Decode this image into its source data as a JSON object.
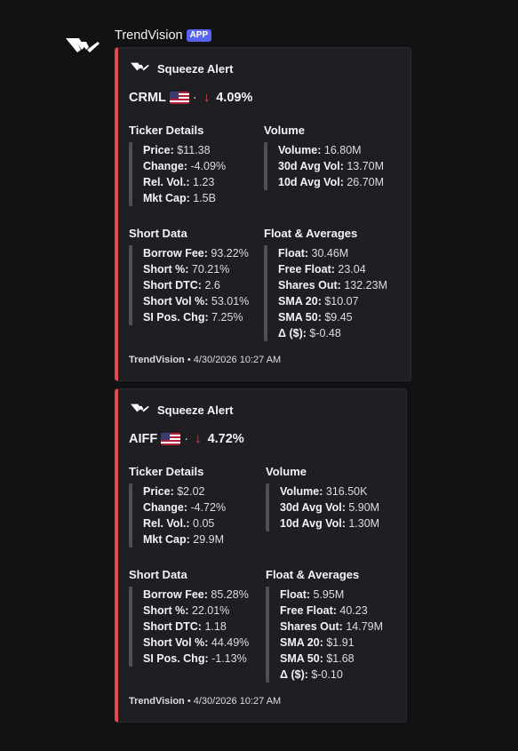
{
  "message": {
    "username": "TrendVision",
    "badge": "APP",
    "avatar_icon": "trendvision-logo-icon"
  },
  "colors": {
    "accent_bar": "#e5484d",
    "badge": "#5865f2",
    "down_arrow": "#e5484d"
  },
  "embeds": [
    {
      "author": "Squeeze Alert",
      "ticker": "CRML",
      "separator": "·",
      "arrow": "↓",
      "change_pct": "4.09%",
      "flag_icon": "us-flag-icon",
      "ticker_details": {
        "title": "Ticker Details",
        "lines": [
          {
            "label": "Price:",
            "value": " $11.38"
          },
          {
            "label": "Change:",
            "value": " -4.09%"
          },
          {
            "label": "Rel. Vol.:",
            "value": " 1.23"
          },
          {
            "label": "Mkt Cap:",
            "value": " 1.5B"
          }
        ]
      },
      "volume": {
        "title": "Volume",
        "lines": [
          {
            "label": "Volume:",
            "value": " 16.80M"
          },
          {
            "label": "30d Avg Vol:",
            "value": " 13.70M"
          },
          {
            "label": "10d Avg Vol:",
            "value": " 26.70M"
          }
        ]
      },
      "short_data": {
        "title": "Short Data",
        "lines": [
          {
            "label": "Borrow Fee:",
            "value": " 93.22%"
          },
          {
            "label": "Short %:",
            "value": " 70.21%"
          },
          {
            "label": "Short DTC:",
            "value": " 2.6"
          },
          {
            "label": "Short Vol %:",
            "value": " 53.01%"
          },
          {
            "label": "SI Pos. Chg:",
            "value": " 7.25%"
          }
        ]
      },
      "float_averages": {
        "title": "Float & Averages",
        "lines": [
          {
            "label": "Float:",
            "value": " 30.46M"
          },
          {
            "label": "Free Float:",
            "value": " 23.04"
          },
          {
            "label": "Shares Out:",
            "value": " 132.23M"
          },
          {
            "label": "SMA 20:",
            "value": " $10.07"
          },
          {
            "label": "SMA 50:",
            "value": " $9.45"
          },
          {
            "label": "Δ ($):",
            "value": " $-0.48"
          }
        ]
      },
      "footer_name": "TrendVision",
      "footer_time": " • 4/30/2026 10:27 AM"
    },
    {
      "author": "Squeeze Alert",
      "ticker": "AIFF",
      "separator": "·",
      "arrow": "↓",
      "change_pct": "4.72%",
      "flag_icon": "us-flag-icon",
      "ticker_details": {
        "title": "Ticker Details",
        "lines": [
          {
            "label": "Price:",
            "value": " $2.02"
          },
          {
            "label": "Change:",
            "value": " -4.72%"
          },
          {
            "label": "Rel. Vol.:",
            "value": " 0.05"
          },
          {
            "label": "Mkt Cap:",
            "value": " 29.9M"
          }
        ]
      },
      "volume": {
        "title": "Volume",
        "lines": [
          {
            "label": "Volume:",
            "value": " 316.50K"
          },
          {
            "label": "30d Avg Vol:",
            "value": " 5.90M"
          },
          {
            "label": "10d Avg Vol:",
            "value": " 1.30M"
          }
        ]
      },
      "short_data": {
        "title": "Short Data",
        "lines": [
          {
            "label": "Borrow Fee:",
            "value": " 85.28%"
          },
          {
            "label": "Short %:",
            "value": " 22.01%"
          },
          {
            "label": "Short DTC:",
            "value": " 1.18"
          },
          {
            "label": "Short Vol %:",
            "value": " 44.49%"
          },
          {
            "label": "SI Pos. Chg:",
            "value": " -1.13%"
          }
        ]
      },
      "float_averages": {
        "title": "Float & Averages",
        "lines": [
          {
            "label": "Float:",
            "value": " 5.95M"
          },
          {
            "label": "Free Float:",
            "value": " 40.23"
          },
          {
            "label": "Shares Out:",
            "value": " 14.79M"
          },
          {
            "label": "SMA 20:",
            "value": " $1.91"
          },
          {
            "label": "SMA 50:",
            "value": " $1.68"
          },
          {
            "label": "Δ ($):",
            "value": " $-0.10"
          }
        ]
      },
      "footer_name": "TrendVision",
      "footer_time": " • 4/30/2026 10:27 AM"
    }
  ]
}
